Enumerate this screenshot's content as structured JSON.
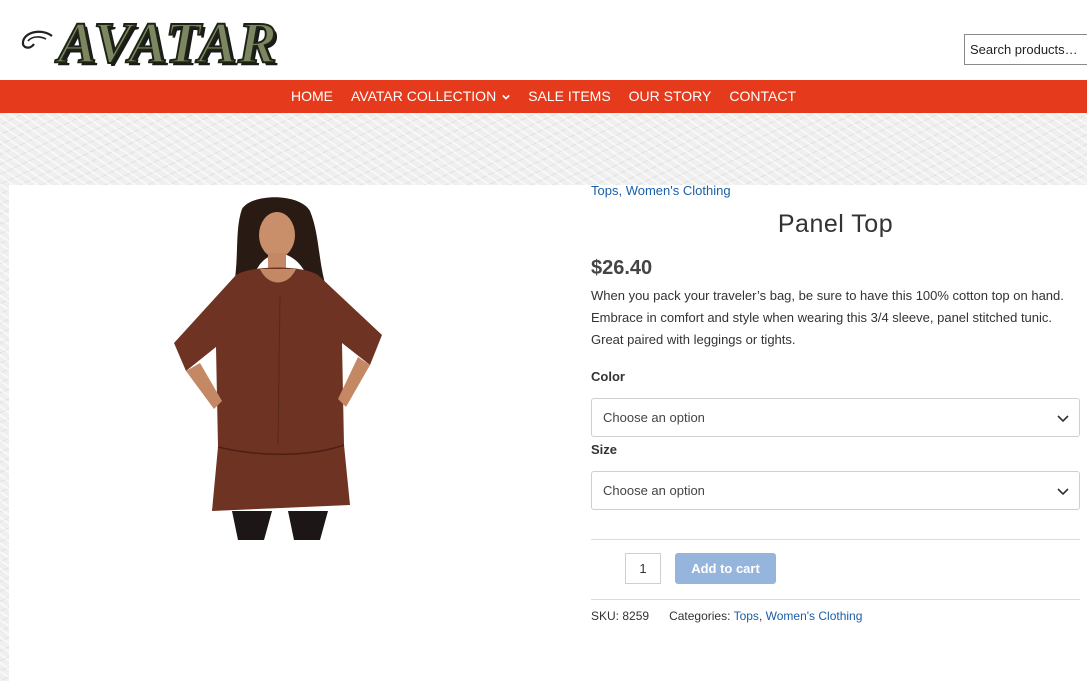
{
  "header": {
    "logo_text": "AVATAR",
    "search_placeholder": "Search products…"
  },
  "nav": {
    "items": [
      {
        "label": "HOME"
      },
      {
        "label": "AVATAR COLLECTION",
        "has_dropdown": true
      },
      {
        "label": "SALE ITEMS"
      },
      {
        "label": "OUR STORY"
      },
      {
        "label": "CONTACT"
      }
    ]
  },
  "product": {
    "categories_top": [
      "Tops",
      "Women's Clothing"
    ],
    "title": "Panel Top",
    "price": "$26.40",
    "description": "When you pack your traveler’s bag, be sure to have this 100% cotton top on hand. Embrace in comfort and style when wearing this 3/4 sleeve, panel stitched tunic. Great paired with leggings or tights.",
    "color": {
      "label": "Color",
      "value": "Choose an option"
    },
    "size": {
      "label": "Size",
      "value": "Choose an option"
    },
    "quantity": "1",
    "add_to_cart": "Add to cart",
    "sku_label": "SKU:",
    "sku": "8259",
    "categories_label": "Categories:",
    "categories": [
      "Tops",
      "Women's Clothing"
    ]
  },
  "colors": {
    "nav_bg": "#e63a1c",
    "link": "#1a5fa8",
    "button": "#96b5dc",
    "logo_fill": "#7c8660"
  }
}
